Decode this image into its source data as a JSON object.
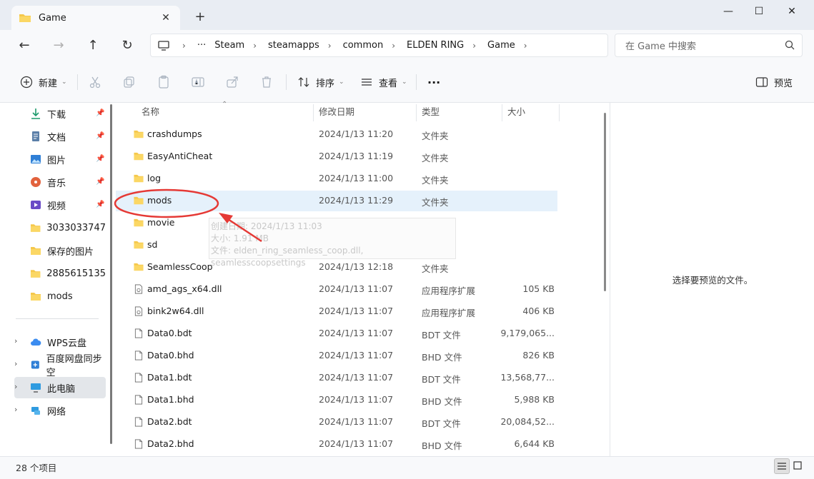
{
  "window": {
    "tab_title": "Game",
    "new_tab": "+",
    "minimize": "—",
    "maximize": "☐",
    "close": "✕"
  },
  "address": {
    "crumbs": [
      "Steam",
      "steamapps",
      "common",
      "ELDEN RING",
      "Game"
    ],
    "search_placeholder": "在 Game 中搜索"
  },
  "toolbar": {
    "new_label": "新建",
    "sort_label": "排序",
    "view_label": "查看",
    "more_label": "···",
    "preview_label": "预览"
  },
  "sidebar": {
    "items": [
      {
        "label": "下载",
        "icon": "download-icon",
        "pinned": true
      },
      {
        "label": "文档",
        "icon": "document-icon",
        "pinned": true
      },
      {
        "label": "图片",
        "icon": "pictures-icon",
        "pinned": true
      },
      {
        "label": "音乐",
        "icon": "music-icon",
        "pinned": true
      },
      {
        "label": "视频",
        "icon": "video-icon",
        "pinned": true
      },
      {
        "label": "3033033747",
        "icon": "folder-icon"
      },
      {
        "label": "保存的图片",
        "icon": "folder-icon"
      },
      {
        "label": "2885615135",
        "icon": "folder-icon"
      },
      {
        "label": "mods",
        "icon": "folder-icon"
      },
      {
        "label": "WPS云盘",
        "icon": "cloud-icon"
      },
      {
        "label": "百度网盘同步空",
        "icon": "baidu-icon"
      },
      {
        "label": "此电脑",
        "icon": "computer-icon"
      },
      {
        "label": "网络",
        "icon": "network-icon"
      }
    ]
  },
  "columns": {
    "name": "名称",
    "date": "修改日期",
    "type": "类型",
    "size": "大小"
  },
  "files": [
    {
      "name": "crashdumps",
      "date": "2024/1/13 11:20",
      "type": "文件夹",
      "size": "",
      "kind": "folder"
    },
    {
      "name": "EasyAntiCheat",
      "date": "2024/1/13 11:19",
      "type": "文件夹",
      "size": "",
      "kind": "folder"
    },
    {
      "name": "log",
      "date": "2024/1/13 11:00",
      "type": "文件夹",
      "size": "",
      "kind": "folder"
    },
    {
      "name": "mods",
      "date": "2024/1/13 11:29",
      "type": "文件夹",
      "size": "",
      "kind": "folder",
      "selected": true
    },
    {
      "name": "movie",
      "date": "2024/1/13 11:19",
      "type": "文件夹",
      "size": "",
      "kind": "folder"
    },
    {
      "name": "sd",
      "date": "2024/1/13 11:19",
      "type": "文件夹",
      "size": "",
      "kind": "folder"
    },
    {
      "name": "SeamlessCoop",
      "date": "2024/1/13 12:18",
      "type": "文件夹",
      "size": "",
      "kind": "folder"
    },
    {
      "name": "amd_ags_x64.dll",
      "date": "2024/1/13 11:07",
      "type": "应用程序扩展",
      "size": "105 KB",
      "kind": "dll"
    },
    {
      "name": "bink2w64.dll",
      "date": "2024/1/13 11:07",
      "type": "应用程序扩展",
      "size": "406 KB",
      "kind": "dll"
    },
    {
      "name": "Data0.bdt",
      "date": "2024/1/13 11:07",
      "type": "BDT 文件",
      "size": "9,179,065...",
      "kind": "file"
    },
    {
      "name": "Data0.bhd",
      "date": "2024/1/13 11:07",
      "type": "BHD 文件",
      "size": "826 KB",
      "kind": "file"
    },
    {
      "name": "Data1.bdt",
      "date": "2024/1/13 11:07",
      "type": "BDT 文件",
      "size": "13,568,77...",
      "kind": "file"
    },
    {
      "name": "Data1.bhd",
      "date": "2024/1/13 11:07",
      "type": "BHD 文件",
      "size": "5,988 KB",
      "kind": "file"
    },
    {
      "name": "Data2.bdt",
      "date": "2024/1/13 11:07",
      "type": "BDT 文件",
      "size": "20,084,52...",
      "kind": "file"
    },
    {
      "name": "Data2.bhd",
      "date": "2024/1/13 11:07",
      "type": "BHD 文件",
      "size": "6,644 KB",
      "kind": "file"
    }
  ],
  "tooltip": {
    "line1": "创建日期: 2024/1/13 11:03",
    "line2": "大小: 1.91 MB",
    "line3": "文件: elden_ring_seamless_coop.dll, seamlesscoopsettings"
  },
  "preview_message": "选择要预览的文件。",
  "status": {
    "item_count": "28 个项目"
  },
  "colors": {
    "folder": "#f5c84c",
    "selection": "#e5f1fb",
    "annotation": "#e53935"
  }
}
